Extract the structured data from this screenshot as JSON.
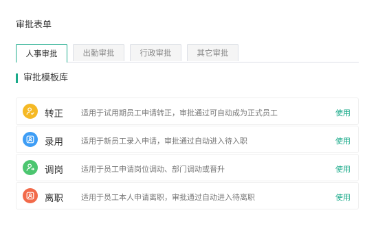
{
  "page": {
    "title": "审批表单"
  },
  "tabs": [
    {
      "label": "人事审批",
      "active": true
    },
    {
      "label": "出勤审批",
      "active": false
    },
    {
      "label": "行政审批",
      "active": false
    },
    {
      "label": "其它审批",
      "active": false
    }
  ],
  "section": {
    "title": "审批模板库"
  },
  "templates": [
    {
      "icon": "person-check-icon",
      "color": "#f5b925",
      "name": "转正",
      "description": "适用于试用期员工申请转正，审批通过可自动成为正式员工",
      "action": "使用"
    },
    {
      "icon": "person-add-icon",
      "color": "#3e9df5",
      "name": "录用",
      "description": "适用于新员工录入申请，审批通过自动进入待入职",
      "action": "使用"
    },
    {
      "icon": "person-transfer-icon",
      "color": "#4cc670",
      "name": "调岗",
      "description": "适用于员工申请岗位调动、部门调动或晋升",
      "action": "使用"
    },
    {
      "icon": "person-leave-icon",
      "color": "#f26a4a",
      "name": "离职",
      "description": "适用于员工本人申请离职，审批通过自动进入待离职",
      "action": "使用"
    }
  ],
  "colors": {
    "accent": "#1aaa8a"
  }
}
